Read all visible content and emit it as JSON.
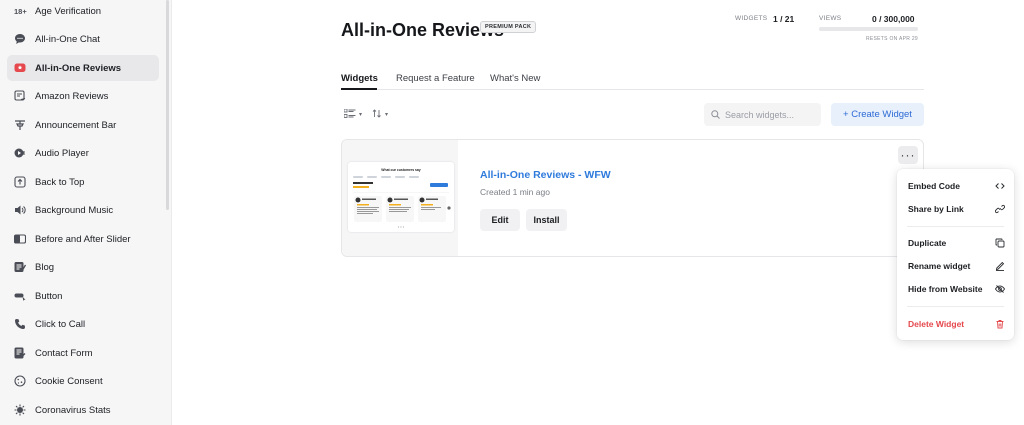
{
  "sidebar": {
    "items": [
      {
        "label": "Age Verification",
        "icon": "age-18-icon",
        "badge": "18+"
      },
      {
        "label": "All-in-One Chat",
        "icon": "chat-bubble-icon"
      },
      {
        "label": "All-in-One Reviews",
        "icon": "reviews-icon",
        "active": true
      },
      {
        "label": "Amazon Reviews",
        "icon": "amazon-reviews-icon"
      },
      {
        "label": "Announcement Bar",
        "icon": "announcement-icon"
      },
      {
        "label": "Audio Player",
        "icon": "audio-player-icon"
      },
      {
        "label": "Back to Top",
        "icon": "back-to-top-icon"
      },
      {
        "label": "Background Music",
        "icon": "speaker-icon"
      },
      {
        "label": "Before and After Slider",
        "icon": "before-after-icon"
      },
      {
        "label": "Blog",
        "icon": "blog-icon"
      },
      {
        "label": "Button",
        "icon": "button-icon"
      },
      {
        "label": "Click to Call",
        "icon": "phone-icon"
      },
      {
        "label": "Contact Form",
        "icon": "contact-form-icon"
      },
      {
        "label": "Cookie Consent",
        "icon": "cookie-icon"
      },
      {
        "label": "Coronavirus Stats",
        "icon": "virus-icon"
      }
    ]
  },
  "header": {
    "title": "All-in-One Reviews",
    "badge": "PREMIUM PACK",
    "widgets_label": "WIDGETS",
    "widgets_value": "1 / 21",
    "views_label": "VIEWS",
    "views_value": "0 / 300,000",
    "views_progress": 0,
    "resets": "RESETS ON APR 29"
  },
  "tabs": [
    {
      "label": "Widgets",
      "active": true
    },
    {
      "label": "Request a Feature"
    },
    {
      "label": "What's New"
    }
  ],
  "toolbar": {
    "search_placeholder": "Search widgets...",
    "create_label": "+ Create Widget"
  },
  "widget": {
    "name": "All-in-One Reviews - WFW",
    "created": "Created 1 min ago",
    "edit_label": "Edit",
    "install_label": "Install",
    "preview_title": "What our customers say"
  },
  "menu": {
    "embed": "Embed Code",
    "share": "Share by Link",
    "duplicate": "Duplicate",
    "rename": "Rename widget",
    "hide": "Hide from Website",
    "delete": "Delete Widget"
  },
  "colors": {
    "accent": "#2f7bdc",
    "active_icon": "#e5484d",
    "danger": "#e5484d",
    "create_bg": "#e7f0fb"
  }
}
